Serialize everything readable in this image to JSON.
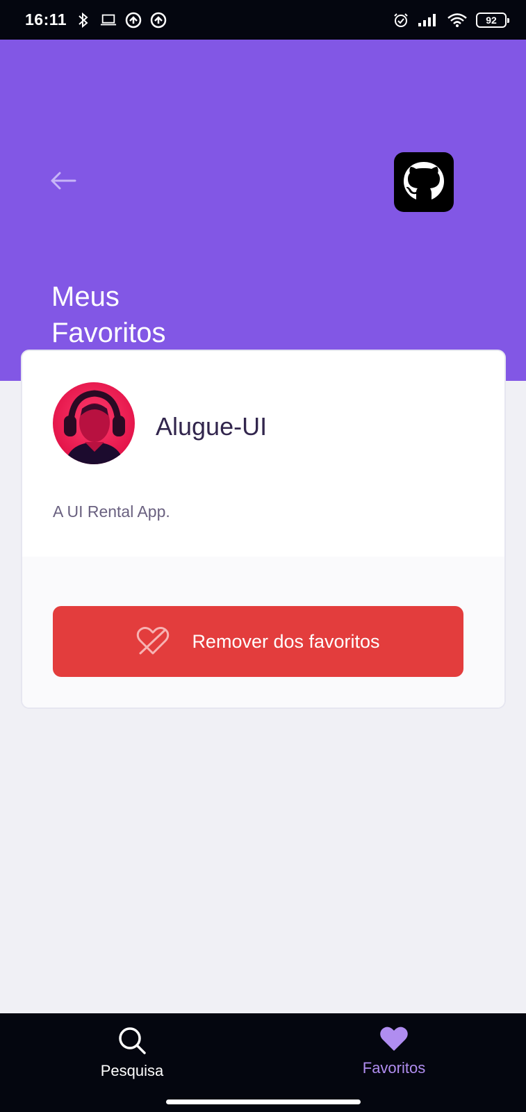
{
  "status_bar": {
    "time": "16:11",
    "battery": "92",
    "icons": [
      "bluetooth-icon",
      "laptop-icon",
      "sync-icon",
      "sync-icon",
      "alarm-icon",
      "signal-icon",
      "wifi-icon",
      "battery-icon"
    ]
  },
  "header": {
    "title": "Meus Favoritos",
    "back_icon": "arrow-left-icon",
    "logo_icon": "github-icon",
    "background_color": "#8257e5"
  },
  "favorite_card": {
    "repo_name": "Alugue-UI",
    "description": "A UI Rental App.",
    "remove_button_label": "Remover dos favoritos",
    "remove_icon": "heart-off-icon",
    "button_color": "#e33d3d"
  },
  "bottom_nav": {
    "items": [
      {
        "label": "Pesquisa",
        "icon": "search-icon",
        "active": false
      },
      {
        "label": "Favoritos",
        "icon": "heart-icon",
        "active": true
      }
    ],
    "active_color": "#b08df0"
  }
}
